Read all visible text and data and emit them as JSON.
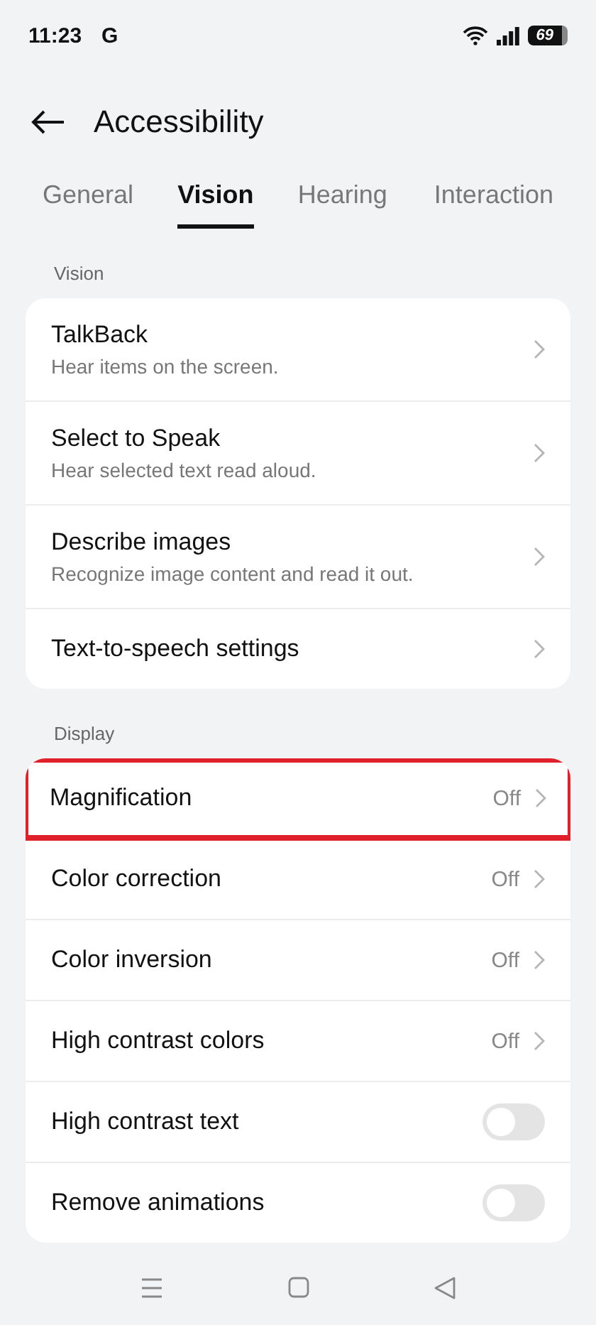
{
  "status_bar": {
    "time": "11:23",
    "carrier": "G",
    "battery": "69"
  },
  "header": {
    "title": "Accessibility"
  },
  "tabs": [
    {
      "label": "General",
      "selected": false
    },
    {
      "label": "Vision",
      "selected": true
    },
    {
      "label": "Hearing",
      "selected": false
    },
    {
      "label": "Interaction",
      "selected": false
    }
  ],
  "sections": [
    {
      "title": "Vision",
      "items": [
        {
          "kind": "link",
          "title": "TalkBack",
          "subtitle": "Hear items on the screen.",
          "highlighted": false
        },
        {
          "kind": "link",
          "title": "Select to Speak",
          "subtitle": "Hear selected text read aloud.",
          "highlighted": false
        },
        {
          "kind": "link",
          "title": "Describe images",
          "subtitle": "Recognize image content and read it out.",
          "highlighted": false
        },
        {
          "kind": "link",
          "title": "Text-to-speech settings",
          "highlighted": false
        }
      ]
    },
    {
      "title": "Display",
      "items": [
        {
          "kind": "link",
          "title": "Magnification",
          "value": "Off",
          "highlighted": true
        },
        {
          "kind": "link",
          "title": "Color correction",
          "value": "Off",
          "highlighted": false
        },
        {
          "kind": "link",
          "title": "Color inversion",
          "value": "Off",
          "highlighted": false
        },
        {
          "kind": "link",
          "title": "High contrast colors",
          "value": "Off",
          "highlighted": false
        },
        {
          "kind": "toggle",
          "title": "High contrast text",
          "on": false,
          "highlighted": false
        },
        {
          "kind": "toggle",
          "title": "Remove animations",
          "on": false,
          "highlighted": false
        }
      ]
    }
  ]
}
